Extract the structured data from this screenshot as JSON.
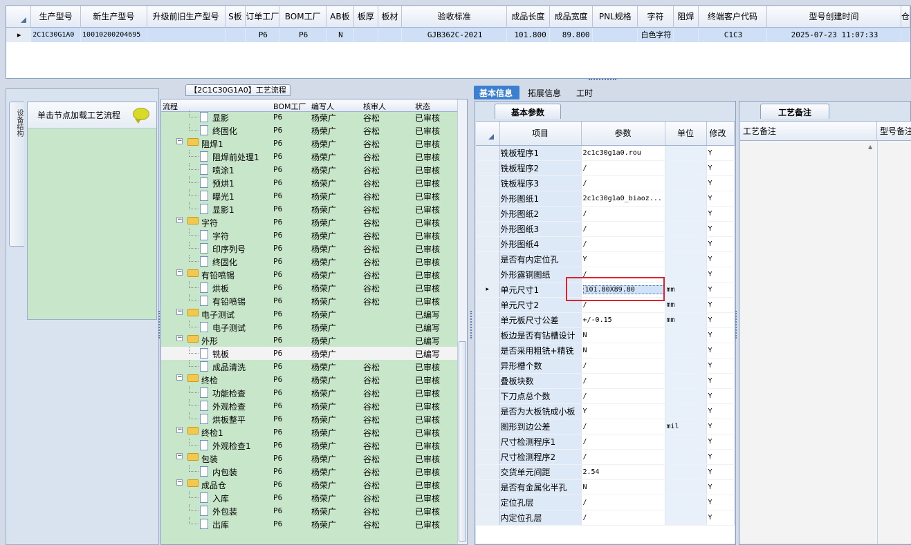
{
  "top_grid": {
    "columns": [
      "生产型号",
      "新生产型号",
      "升级前旧生产型号",
      "S板",
      "订单工厂",
      "BOM工厂",
      "AB板",
      "板厚",
      "板材",
      "验收标准",
      "成品长度",
      "成品宽度",
      "PNL规格",
      "字符",
      "阻焊",
      "终端客户代码",
      "型号创建时间",
      "仓"
    ],
    "row": {
      "indicator": "▸",
      "生产型号": "2C1C30G1A0",
      "新生产型号": "10010200204695",
      "升级前旧生产型号": "",
      "S板": "",
      "订单工厂": "P6",
      "BOM工厂": "P6",
      "AB板": "N",
      "板厚": "",
      "板材": "",
      "验收标准": "GJB362C-2021",
      "成品长度": "101.800",
      "成品宽度": "89.800",
      "PNL规格": "",
      "字符": "白色字符",
      "阻焊": "",
      "终端客户代码": "C1C3",
      "型号创建时间": "2025-07-23 11:07:33",
      "仓": ""
    }
  },
  "left_panel": {
    "vertical_tab": "设备结构",
    "hint": "单击节点加载工艺流程"
  },
  "process": {
    "title": "【2C1C30G1A0】工艺流程",
    "columns": {
      "flow": "流程",
      "bom": "BOM工厂",
      "writer": "编写人",
      "reviewer": "核审人",
      "status": "状态"
    },
    "rows": [
      {
        "level": 2,
        "name": "显影",
        "bom": "P6",
        "writer": "杨荣广",
        "reviewer": "谷松",
        "status": "已审核"
      },
      {
        "level": 2,
        "name": "终固化",
        "bom": "P6",
        "writer": "杨荣广",
        "reviewer": "谷松",
        "status": "已审核"
      },
      {
        "level": 1,
        "name": "阻焊1",
        "bom": "P6",
        "writer": "杨荣广",
        "reviewer": "谷松",
        "status": "已审核"
      },
      {
        "level": 2,
        "name": "阻焊前处理1",
        "bom": "P6",
        "writer": "杨荣广",
        "reviewer": "谷松",
        "status": "已审核"
      },
      {
        "level": 2,
        "name": "喷涂1",
        "bom": "P6",
        "writer": "杨荣广",
        "reviewer": "谷松",
        "status": "已审核"
      },
      {
        "level": 2,
        "name": "预烘1",
        "bom": "P6",
        "writer": "杨荣广",
        "reviewer": "谷松",
        "status": "已审核"
      },
      {
        "level": 2,
        "name": "曝光1",
        "bom": "P6",
        "writer": "杨荣广",
        "reviewer": "谷松",
        "status": "已审核"
      },
      {
        "level": 2,
        "name": "显影1",
        "bom": "P6",
        "writer": "杨荣广",
        "reviewer": "谷松",
        "status": "已审核"
      },
      {
        "level": 1,
        "name": "字符",
        "bom": "P6",
        "writer": "杨荣广",
        "reviewer": "谷松",
        "status": "已审核"
      },
      {
        "level": 2,
        "name": "字符",
        "bom": "P6",
        "writer": "杨荣广",
        "reviewer": "谷松",
        "status": "已审核"
      },
      {
        "level": 2,
        "name": "印序列号",
        "bom": "P6",
        "writer": "杨荣广",
        "reviewer": "谷松",
        "status": "已审核"
      },
      {
        "level": 2,
        "name": "终固化",
        "bom": "P6",
        "writer": "杨荣广",
        "reviewer": "谷松",
        "status": "已审核"
      },
      {
        "level": 1,
        "name": "有铅喷锡",
        "bom": "P6",
        "writer": "杨荣广",
        "reviewer": "谷松",
        "status": "已审核"
      },
      {
        "level": 2,
        "name": "烘板",
        "bom": "P6",
        "writer": "杨荣广",
        "reviewer": "谷松",
        "status": "已审核"
      },
      {
        "level": 2,
        "name": "有铅喷锡",
        "bom": "P6",
        "writer": "杨荣广",
        "reviewer": "谷松",
        "status": "已审核"
      },
      {
        "level": 1,
        "name": "电子测试",
        "bom": "P6",
        "writer": "杨荣广",
        "reviewer": "",
        "status": "已编写"
      },
      {
        "level": 2,
        "name": "电子测试",
        "bom": "P6",
        "writer": "杨荣广",
        "reviewer": "",
        "status": "已编写"
      },
      {
        "level": 1,
        "name": "外形",
        "bom": "P6",
        "writer": "杨荣广",
        "reviewer": "",
        "status": "已编写"
      },
      {
        "level": 2,
        "name": "铣板",
        "bom": "P6",
        "writer": "杨荣广",
        "reviewer": "",
        "status": "已编写",
        "selected": true
      },
      {
        "level": 2,
        "name": "成品清洗",
        "bom": "P6",
        "writer": "杨荣广",
        "reviewer": "谷松",
        "status": "已审核"
      },
      {
        "level": 1,
        "name": "终检",
        "bom": "P6",
        "writer": "杨荣广",
        "reviewer": "谷松",
        "status": "已审核"
      },
      {
        "level": 2,
        "name": "功能检查",
        "bom": "P6",
        "writer": "杨荣广",
        "reviewer": "谷松",
        "status": "已审核"
      },
      {
        "level": 2,
        "name": "外观检查",
        "bom": "P6",
        "writer": "杨荣广",
        "reviewer": "谷松",
        "status": "已审核"
      },
      {
        "level": 2,
        "name": "烘板整平",
        "bom": "P6",
        "writer": "杨荣广",
        "reviewer": "谷松",
        "status": "已审核"
      },
      {
        "level": 1,
        "name": "终检1",
        "bom": "P6",
        "writer": "杨荣广",
        "reviewer": "谷松",
        "status": "已审核"
      },
      {
        "level": 2,
        "name": "外观检查1",
        "bom": "P6",
        "writer": "杨荣广",
        "reviewer": "谷松",
        "status": "已审核"
      },
      {
        "level": 1,
        "name": "包装",
        "bom": "P6",
        "writer": "杨荣广",
        "reviewer": "谷松",
        "status": "已审核"
      },
      {
        "level": 2,
        "name": "内包装",
        "bom": "P6",
        "writer": "杨荣广",
        "reviewer": "谷松",
        "status": "已审核"
      },
      {
        "level": 1,
        "name": "成品仓",
        "bom": "P6",
        "writer": "杨荣广",
        "reviewer": "谷松",
        "status": "已审核"
      },
      {
        "level": 2,
        "name": "入库",
        "bom": "P6",
        "writer": "杨荣广",
        "reviewer": "谷松",
        "status": "已审核"
      },
      {
        "level": 2,
        "name": "外包装",
        "bom": "P6",
        "writer": "杨荣广",
        "reviewer": "谷松",
        "status": "已审核"
      },
      {
        "level": 2,
        "name": "出库",
        "bom": "P6",
        "writer": "杨荣广",
        "reviewer": "谷松",
        "status": "已审核"
      }
    ]
  },
  "tabs": [
    "基本信息",
    "拓展信息",
    "工时"
  ],
  "basic": {
    "subtab": "基本参数",
    "columns": {
      "item": "项目",
      "param": "参数",
      "unit": "单位",
      "mod": "修改"
    },
    "rows": [
      {
        "item": "铣板程序1",
        "param": "2c1c30g1a0.rou",
        "unit": "",
        "mod": "Y"
      },
      {
        "item": "铣板程序2",
        "param": "/",
        "unit": "",
        "mod": "Y"
      },
      {
        "item": "铣板程序3",
        "param": "/",
        "unit": "",
        "mod": "Y"
      },
      {
        "item": "外形图纸1",
        "param": "2c1c30g1a0_biaoz...",
        "unit": "",
        "mod": "Y"
      },
      {
        "item": "外形图纸2",
        "param": "/",
        "unit": "",
        "mod": "Y"
      },
      {
        "item": "外形图纸3",
        "param": "/",
        "unit": "",
        "mod": "Y"
      },
      {
        "item": "外形图纸4",
        "param": "/",
        "unit": "",
        "mod": "Y"
      },
      {
        "item": "是否有内定位孔",
        "param": "Y",
        "unit": "",
        "mod": "Y"
      },
      {
        "item": "外形露铜图纸",
        "param": "/",
        "unit": "",
        "mod": "Y"
      },
      {
        "item": "单元尺寸1",
        "param": "101.80X89.80",
        "unit": "mm",
        "mod": "Y",
        "selected": true
      },
      {
        "item": "单元尺寸2",
        "param": "/",
        "unit": "mm",
        "mod": "Y"
      },
      {
        "item": "单元板尺寸公差",
        "param": "+/-0.15",
        "unit": "mm",
        "mod": "Y"
      },
      {
        "item": "板边是否有钻槽设计",
        "param": "N",
        "unit": "",
        "mod": "Y"
      },
      {
        "item": "是否采用粗铣+精铣",
        "param": "N",
        "unit": "",
        "mod": "Y"
      },
      {
        "item": "异形槽个数",
        "param": "/",
        "unit": "",
        "mod": "Y"
      },
      {
        "item": "叠板块数",
        "param": "/",
        "unit": "",
        "mod": "Y"
      },
      {
        "item": "下刀点总个数",
        "param": "/",
        "unit": "",
        "mod": "Y"
      },
      {
        "item": "是否为大板铣成小板",
        "param": "Y",
        "unit": "",
        "mod": "Y"
      },
      {
        "item": "图形到边公差",
        "param": "/",
        "unit": "mil",
        "mod": "Y"
      },
      {
        "item": "尺寸检测程序1",
        "param": "/",
        "unit": "",
        "mod": "Y"
      },
      {
        "item": "尺寸检测程序2",
        "param": "/",
        "unit": "",
        "mod": "Y"
      },
      {
        "item": "交货单元间距",
        "param": "2.54",
        "unit": "",
        "mod": "Y"
      },
      {
        "item": "是否有金属化半孔",
        "param": "N",
        "unit": "",
        "mod": "Y"
      },
      {
        "item": "定位孔层",
        "param": "/",
        "unit": "",
        "mod": "Y"
      },
      {
        "item": "内定位孔层",
        "param": "/",
        "unit": "",
        "mod": "Y"
      }
    ]
  },
  "notes": {
    "subtab": "工艺备注",
    "columns": [
      "工艺备注",
      "型号备注"
    ]
  }
}
